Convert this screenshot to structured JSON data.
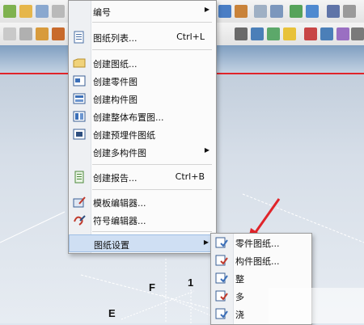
{
  "menu": {
    "items": [
      {
        "label": "编号",
        "shortcut": "",
        "submenu": true,
        "icon": "none"
      },
      {
        "label": "图纸列表...",
        "shortcut": "Ctrl+L",
        "submenu": false,
        "icon": "drawing-list-icon"
      },
      {
        "label": "创建图纸...",
        "shortcut": "",
        "submenu": false,
        "icon": "create-drawing-icon"
      },
      {
        "label": "创建零件图",
        "shortcut": "",
        "submenu": false,
        "icon": "part-drawing-icon"
      },
      {
        "label": "创建构件图",
        "shortcut": "",
        "submenu": false,
        "icon": "assembly-drawing-icon"
      },
      {
        "label": "创建整体布置图...",
        "shortcut": "",
        "submenu": false,
        "icon": "ga-drawing-icon"
      },
      {
        "label": "创建预埋件图纸",
        "shortcut": "",
        "submenu": false,
        "icon": "embed-drawing-icon"
      },
      {
        "label": "创建多构件图",
        "shortcut": "",
        "submenu": true,
        "icon": "none"
      },
      {
        "label": "创建报告...",
        "shortcut": "Ctrl+B",
        "submenu": false,
        "icon": "report-icon"
      },
      {
        "label": "模板编辑器...",
        "shortcut": "",
        "submenu": false,
        "icon": "template-editor-icon"
      },
      {
        "label": "符号编辑器...",
        "shortcut": "",
        "submenu": false,
        "icon": "symbol-editor-icon"
      },
      {
        "label": "图纸设置",
        "shortcut": "",
        "submenu": true,
        "icon": "none"
      }
    ]
  },
  "submenu": {
    "items": [
      {
        "label": "零件图纸..."
      },
      {
        "label": "构件图纸..."
      },
      {
        "label": "整"
      },
      {
        "label": "多"
      },
      {
        "label": "浇"
      }
    ]
  },
  "scene": {
    "axis_labels": [
      "F",
      "1",
      "E"
    ]
  },
  "colors": {
    "highlight": "#cfdff3",
    "red_arrow": "#e0242a",
    "grid_red": "#e0242a"
  }
}
